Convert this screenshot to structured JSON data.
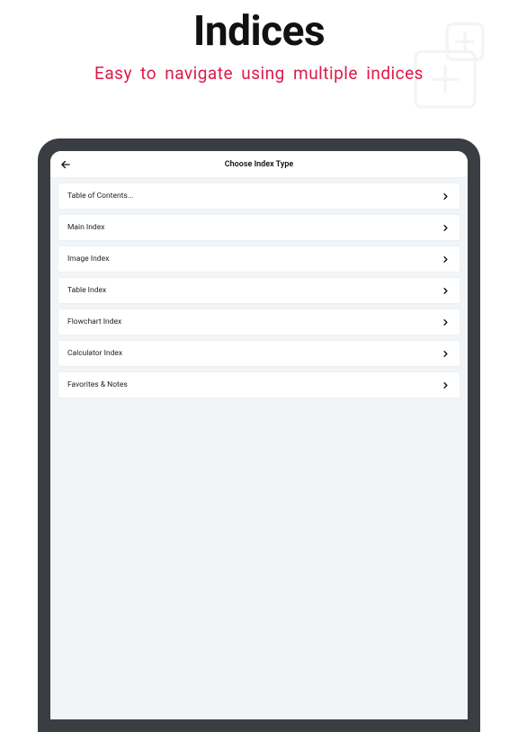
{
  "promo": {
    "title": "Indices",
    "subtitle": "Easy to navigate using multiple indices"
  },
  "nav": {
    "title": "Choose Index Type"
  },
  "items": [
    {
      "label": "Table of Contents..."
    },
    {
      "label": "Main Index"
    },
    {
      "label": "Image Index"
    },
    {
      "label": "Table Index"
    },
    {
      "label": "Flowchart Index"
    },
    {
      "label": "Calculator Index"
    },
    {
      "label": "Favorites & Notes"
    }
  ]
}
